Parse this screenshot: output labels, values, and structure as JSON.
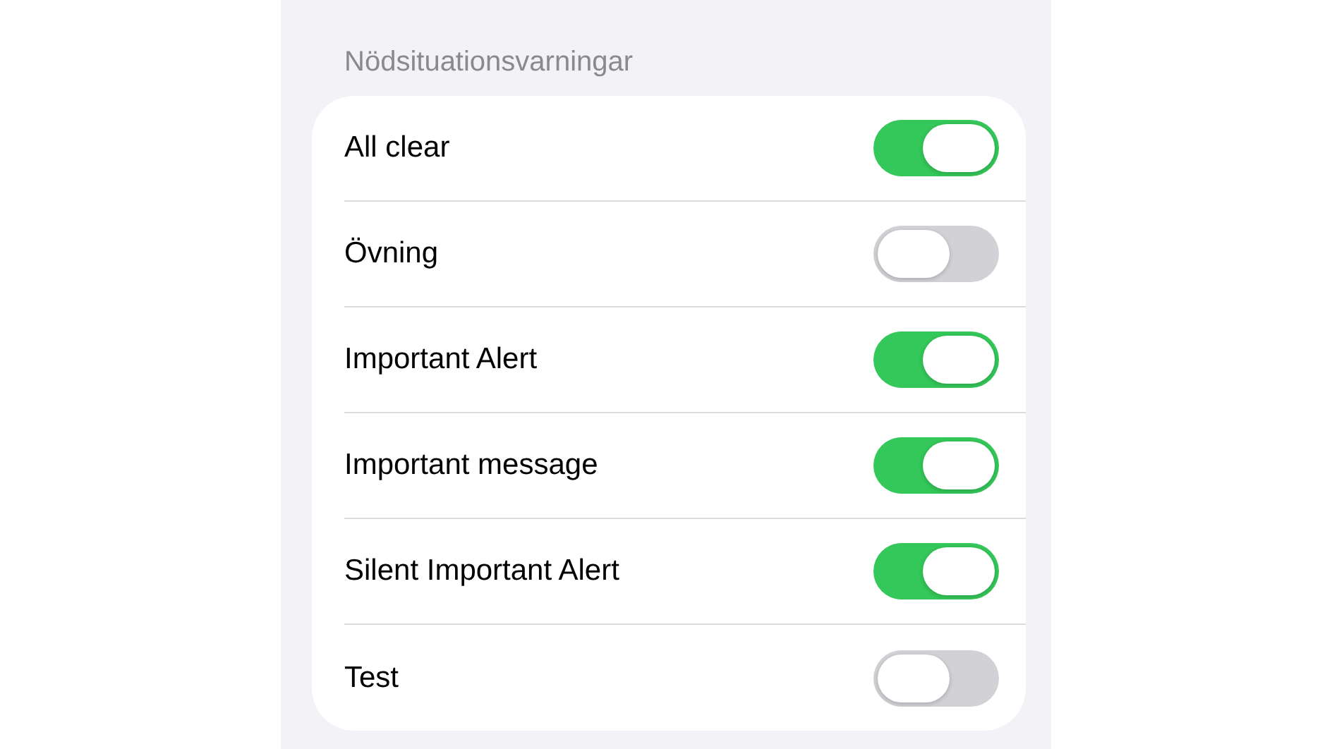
{
  "section": {
    "title": "Nödsituationsvarningar"
  },
  "alerts": [
    {
      "label": "All clear",
      "on": true
    },
    {
      "label": "Övning",
      "on": false
    },
    {
      "label": "Important Alert",
      "on": true
    },
    {
      "label": "Important message",
      "on": true
    },
    {
      "label": "Silent Important Alert",
      "on": true
    },
    {
      "label": "Test",
      "on": false
    }
  ]
}
